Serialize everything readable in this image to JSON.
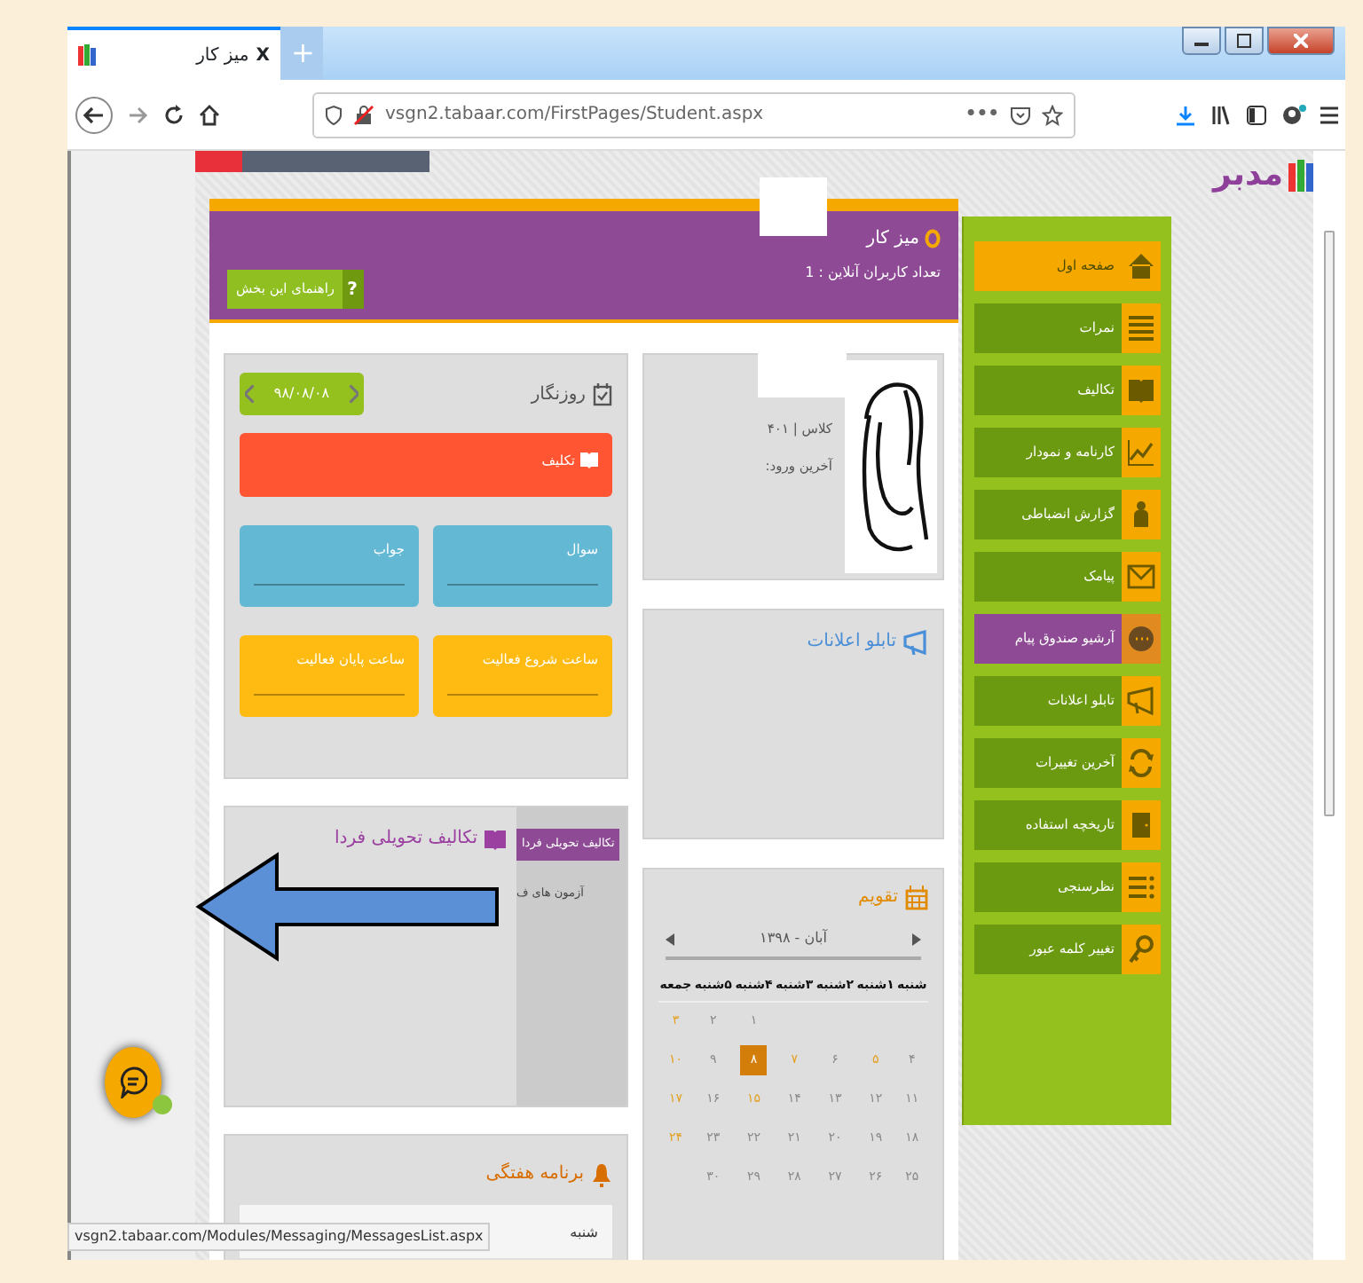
{
  "browser": {
    "tab": {
      "title": "میز کار",
      "close": "X",
      "selected": true
    },
    "new_tab": "+",
    "url": "vsgn2.tabaar.com/FirstPages/Student.aspx",
    "more": "•••",
    "status_url": "vsgn2.tabaar.com/Modules/Messaging/MessagesList.aspx"
  },
  "logo": "مدبر",
  "header": {
    "title": "میز کار",
    "online": "تعداد کاربران آنلاین : 1",
    "help_button": {
      "icon_text": "?",
      "label": "راهنمای این بخش"
    }
  },
  "profile": {
    "class_label": "کلاس | ۴۰۱",
    "last_login": "آخرین ورود:"
  },
  "planner": {
    "title": "روزنگار",
    "date": "۹۸/۰۸/۰۸",
    "cards": [
      {
        "kind": "wide",
        "label": "تکلیف",
        "color": "#ff5533"
      },
      {
        "kind": "half",
        "label": "سوال",
        "color": "#63b8d4"
      },
      {
        "kind": "half",
        "label": "جواب",
        "color": "#63b8d4"
      },
      {
        "kind": "half",
        "label": "ساعت شروع فعالیت",
        "color": "#ffbb11"
      },
      {
        "kind": "half",
        "label": "ساعت پایان فعالیت",
        "color": "#ffbb11"
      }
    ]
  },
  "announcements": {
    "title": "تابلو اعلانات"
  },
  "tomorrow": {
    "title": "تکالیف تحویلی فردا",
    "tab": "تکالیف تحویلی فردا",
    "items": [
      "آزمون های ف"
    ]
  },
  "calendar": {
    "title": "تقویم",
    "month": "آبان - ۱۳۹۸",
    "weekdays": [
      "شنبه",
      "۱شنبه",
      "۲شنبه",
      "۳شنبه",
      "۴شنبه",
      "۵شنبه",
      "جمعه"
    ],
    "weeks": [
      [
        {
          "kind": "blank"
        },
        {
          "kind": "blank"
        },
        {
          "kind": "blank"
        },
        {
          "kind": "blank"
        },
        {
          "kind": "day",
          "label": "۱",
          "holiday": false,
          "selected": false
        },
        {
          "kind": "day",
          "label": "۲",
          "holiday": false,
          "selected": false
        },
        {
          "kind": "day",
          "label": "۳",
          "holiday": true,
          "selected": false
        }
      ],
      [
        {
          "kind": "day",
          "label": "۴",
          "holiday": false,
          "selected": false
        },
        {
          "kind": "day",
          "label": "۵",
          "holiday": true,
          "selected": false
        },
        {
          "kind": "day",
          "label": "۶",
          "holiday": false,
          "selected": false
        },
        {
          "kind": "day",
          "label": "۷",
          "holiday": true,
          "selected": false
        },
        {
          "kind": "day",
          "label": "۸",
          "holiday": false,
          "selected": true
        },
        {
          "kind": "day",
          "label": "۹",
          "holiday": false,
          "selected": false
        },
        {
          "kind": "day",
          "label": "۱۰",
          "holiday": true,
          "selected": false
        }
      ],
      [
        {
          "kind": "day",
          "label": "۱۱",
          "holiday": false,
          "selected": false
        },
        {
          "kind": "day",
          "label": "۱۲",
          "holiday": false,
          "selected": false
        },
        {
          "kind": "day",
          "label": "۱۳",
          "holiday": false,
          "selected": false
        },
        {
          "kind": "day",
          "label": "۱۴",
          "holiday": false,
          "selected": false
        },
        {
          "kind": "day",
          "label": "۱۵",
          "holiday": true,
          "selected": false
        },
        {
          "kind": "day",
          "label": "۱۶",
          "holiday": false,
          "selected": false
        },
        {
          "kind": "day",
          "label": "۱۷",
          "holiday": true,
          "selected": false
        }
      ],
      [
        {
          "kind": "day",
          "label": "۱۸",
          "holiday": false,
          "selected": false
        },
        {
          "kind": "day",
          "label": "۱۹",
          "holiday": false,
          "selected": false
        },
        {
          "kind": "day",
          "label": "۲۰",
          "holiday": false,
          "selected": false
        },
        {
          "kind": "day",
          "label": "۲۱",
          "holiday": false,
          "selected": false
        },
        {
          "kind": "day",
          "label": "۲۲",
          "holiday": false,
          "selected": false
        },
        {
          "kind": "day",
          "label": "۲۳",
          "holiday": false,
          "selected": false
        },
        {
          "kind": "day",
          "label": "۲۴",
          "holiday": true,
          "selected": false
        }
      ],
      [
        {
          "kind": "day",
          "label": "۲۵",
          "holiday": false,
          "selected": false
        },
        {
          "kind": "day",
          "label": "۲۶",
          "holiday": false,
          "selected": false
        },
        {
          "kind": "day",
          "label": "۲۷",
          "holiday": false,
          "selected": false
        },
        {
          "kind": "day",
          "label": "۲۸",
          "holiday": false,
          "selected": false
        },
        {
          "kind": "day",
          "label": "۲۹",
          "holiday": false,
          "selected": false
        },
        {
          "kind": "day",
          "label": "۳۰",
          "holiday": false,
          "selected": false
        },
        {
          "kind": "blank"
        }
      ]
    ]
  },
  "weekly": {
    "title": "برنامه هفتگی",
    "days": [
      "شنبه"
    ]
  },
  "sidebar": {
    "items": [
      {
        "label": "صفحه اول",
        "selected": true,
        "hovered": false
      },
      {
        "label": "نمرات",
        "selected": false,
        "hovered": false
      },
      {
        "label": "تکالیف",
        "selected": false,
        "hovered": false
      },
      {
        "label": "کارنامه و نمودار",
        "selected": false,
        "hovered": false
      },
      {
        "label": "گزارش انضباطی",
        "selected": false,
        "hovered": false
      },
      {
        "label": "پیامک",
        "selected": false,
        "hovered": false
      },
      {
        "label": "آرشیو صندوق پیام",
        "selected": false,
        "hovered": true
      },
      {
        "label": "تابلو اعلانات",
        "selected": false,
        "hovered": false
      },
      {
        "label": "آخرین تغییرات",
        "selected": false,
        "hovered": false
      },
      {
        "label": "تاریخچه استفاده",
        "selected": false,
        "hovered": false
      },
      {
        "label": "نظرسنجی",
        "selected": false,
        "hovered": false
      },
      {
        "label": "تغییر کلمه عبور",
        "selected": false,
        "hovered": false
      }
    ]
  }
}
